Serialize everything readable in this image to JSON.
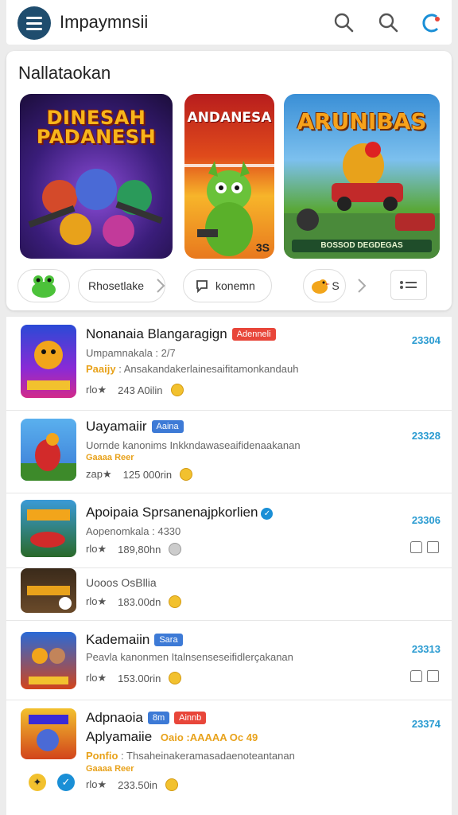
{
  "app": {
    "title": "Impaymnsii",
    "accent": "#1f4d6e",
    "icons": [
      "menu-icon",
      "search-icon",
      "search-icon",
      "account-icon"
    ]
  },
  "featured": {
    "title": "Nallataokan",
    "tiles": [
      {
        "title": "DINESAH PADANESH",
        "icon": "heroes-art"
      },
      {
        "title": "ANDANESA",
        "badge": "3S",
        "icon": "green-creature-art"
      },
      {
        "title": "ARUNIBAS",
        "subtitle": "BOSSOD DEGDEGAS",
        "icon": "car-battle-art"
      }
    ],
    "chips": [
      {
        "icon": "frog-icon"
      },
      {
        "label": "Rhosetlake"
      },
      {
        "label": "konemn",
        "icon": "chat-icon"
      },
      {
        "label": "S",
        "icon": "bird-icon"
      },
      {
        "icon": "more-icon"
      }
    ]
  },
  "list": [
    {
      "title": "Nonanaia Blangaragign",
      "badge": "Adenneli",
      "badge_color": "#e8463a",
      "sub": "Umpamnakala : 2/7",
      "desc_prefix": "Paaijy",
      "desc": "Ansakandakerlainesaifitamonkandauh",
      "tag": "Paaijy",
      "meta_left": "rlo★",
      "meta_value": "243 A0ilin",
      "number": "23304"
    },
    {
      "title": "Uayamaiir",
      "badge": "Aaina",
      "badge_color": "#3d7ad6",
      "sub": "Uornde kanonims  Inkkndawaseaifidenaakanan",
      "tag": "Gaaaa Reer",
      "meta_left": "zap★",
      "meta_value": "125 000rin",
      "number": "23328"
    },
    {
      "title": "Apoipaia Sprsanenajpkorlien",
      "sub": "Aopenomkala : 4330",
      "meta_left": "rlo★",
      "meta_value": "189,80hn",
      "number": "23306"
    },
    {
      "title": "Uooos OsBllia",
      "meta_left": "rlo★",
      "meta_value": "183.00dn"
    },
    {
      "title": "Kademaiin",
      "badge": "Sara",
      "badge_color": "#3d7ad6",
      "sub": "Peavla kanonmen  Italnsenseseifidlerçakanan",
      "meta_left": "rlo★",
      "meta_value": "153.00rin",
      "number": "23313"
    },
    {
      "title": "Adpnaoia",
      "badge": "8m",
      "badge2": "Ainnb",
      "badge_color": "#3d7ad6",
      "badge2_color": "#e8463a",
      "sub": "Aplyamaiie",
      "sub_extra": "Oaio :AAAAA Oc 49",
      "desc_prefix": "Ponfio",
      "desc": "Thsaheinakeramasadaenoteantanan",
      "tag": "Gaaaa Reer",
      "meta_left": "rlo★",
      "meta_value": "233.50in",
      "number": "23374"
    }
  ]
}
